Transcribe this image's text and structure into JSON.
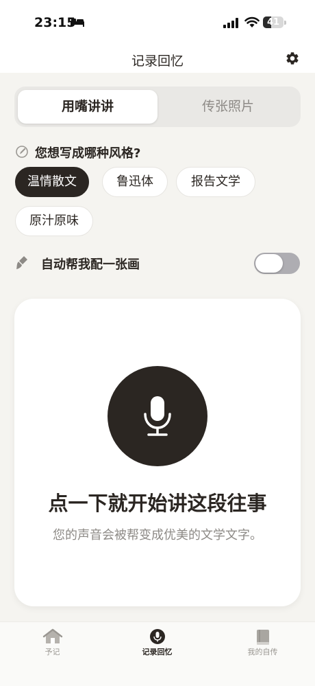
{
  "status_bar": {
    "time": "23:15",
    "battery": "41",
    "battery_level": 0.41
  },
  "header": {
    "title": "记录回忆"
  },
  "segment": {
    "active_label": "用嘴讲讲",
    "inactive_label": "传张照片"
  },
  "style": {
    "question": "您想写成哪种风格?",
    "options": [
      "温情散文",
      "鲁迅体",
      "报告文学",
      "原汁原味"
    ],
    "selected": "温情散文"
  },
  "auto_picture": {
    "label": "自动帮我配一张画",
    "enabled": false
  },
  "record": {
    "title": "点一下就开始讲这段往事",
    "subtitle": "您的声音会被帮变成优美的文学文字。"
  },
  "tabs": [
    {
      "label": "予记",
      "icon": "home-icon",
      "active": false
    },
    {
      "label": "记录回忆",
      "icon": "microphone-icon",
      "active": true
    },
    {
      "label": "我的自传",
      "icon": "book-icon",
      "active": false
    }
  ],
  "colors": {
    "background": "#f5f4f0",
    "accent": "#2b2622",
    "muted": "#8d8a86"
  }
}
